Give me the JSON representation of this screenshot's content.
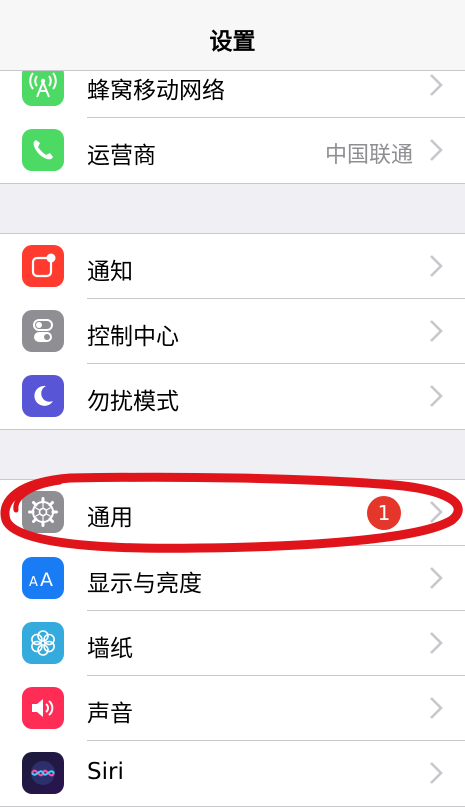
{
  "nav": {
    "title": "设置"
  },
  "group1": [
    {
      "label": "蜂窝移动网络",
      "icon": "cellular-icon",
      "color": "#4cd964"
    },
    {
      "label": "运营商",
      "value": "中国联通",
      "icon": "phone-icon",
      "color": "#4cd964"
    }
  ],
  "group2": [
    {
      "label": "通知",
      "icon": "notification-icon",
      "color": "#ff3b30"
    },
    {
      "label": "控制中心",
      "icon": "control-center-icon",
      "color": "#8e8e93"
    },
    {
      "label": "勿扰模式",
      "icon": "moon-icon",
      "color": "#5856d6"
    }
  ],
  "group3": [
    {
      "label": "通用",
      "badge": "1",
      "icon": "gear-icon",
      "color": "#8e8e93"
    },
    {
      "label": "显示与亮度",
      "icon": "display-text-size-icon",
      "color": "#1a7cf5"
    },
    {
      "label": "墙纸",
      "icon": "wallpaper-flower-icon",
      "color": "#35aadc"
    },
    {
      "label": "声音",
      "icon": "speaker-icon",
      "color": "#ff2d55"
    },
    {
      "label": "Siri",
      "icon": "siri-icon",
      "color": "#1b1b3a"
    }
  ],
  "colors": {
    "annotation": "#e0141b",
    "badge": "#e5362b",
    "separator": "#c8c7cc",
    "background": "#efeff4"
  }
}
